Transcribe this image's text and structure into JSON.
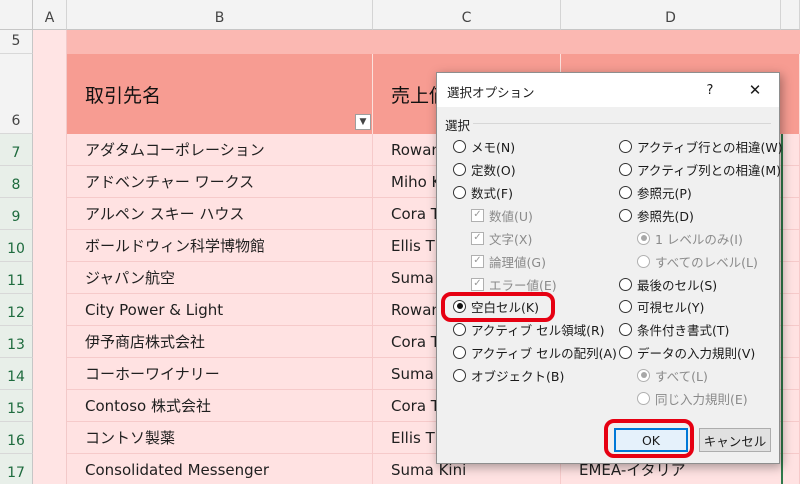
{
  "sheet": {
    "columns": [
      "A",
      "B",
      "C",
      "D"
    ],
    "rows": [
      "5",
      "6",
      "7",
      "8",
      "9",
      "10",
      "11",
      "12",
      "13",
      "14",
      "15",
      "16",
      "17"
    ],
    "header": {
      "b": "取引先名",
      "c": "売上価"
    },
    "data": [
      {
        "b": "アダタムコーポレーション",
        "c": "Rowan",
        "d": ""
      },
      {
        "b": "アドベンチャー ワークス",
        "c": "Miho K",
        "d": ""
      },
      {
        "b": "アルペン スキー ハウス",
        "c": "Cora T",
        "d": ""
      },
      {
        "b": "ボールドウィン科学博物館",
        "c": "Ellis T",
        "d": ""
      },
      {
        "b": "ジャパン航空",
        "c": "Suma",
        "d": ""
      },
      {
        "b": "City Power & Light",
        "c": "Rowan",
        "d": ""
      },
      {
        "b": "伊予商店株式会社",
        "c": "Cora T",
        "d": ""
      },
      {
        "b": "コーホーワイナリー",
        "c": "Suma",
        "d": ""
      },
      {
        "b": "Contoso 株式会社",
        "c": "Cora T",
        "d": ""
      },
      {
        "b": "コントソ製薬",
        "c": "Ellis T",
        "d": ""
      },
      {
        "b": "Consolidated Messenger",
        "c": "Suma Kini",
        "d": "EMEA-イタリア"
      }
    ],
    "filter_glyph": "▼",
    "colors": {
      "header_fill": "#f79c92",
      "row_fill": "#ffe2e2",
      "band_fill": "#fbb8b2"
    }
  },
  "dialog": {
    "title": "選択オプション",
    "help_label": "?",
    "close_label": "✕",
    "section_label": "選択",
    "left_options": [
      {
        "label": "メモ(N)",
        "state": "off"
      },
      {
        "label": "定数(O)",
        "state": "off"
      },
      {
        "label": "数式(F)",
        "state": "off"
      },
      {
        "label": "数値(U)",
        "state": "check-disabled"
      },
      {
        "label": "文字(X)",
        "state": "check-disabled"
      },
      {
        "label": "論理値(G)",
        "state": "check-disabled"
      },
      {
        "label": "エラー値(E)",
        "state": "check-disabled"
      },
      {
        "label": "空白セル(K)",
        "state": "on"
      },
      {
        "label": "アクティブ セル領域(R)",
        "state": "off"
      },
      {
        "label": "アクティブ セルの配列(A)",
        "state": "off"
      },
      {
        "label": "オブジェクト(B)",
        "state": "off"
      }
    ],
    "right_options": [
      {
        "label": "アクティブ行との相違(W)",
        "state": "off"
      },
      {
        "label": "アクティブ列との相違(M)",
        "state": "off"
      },
      {
        "label": "参照元(P)",
        "state": "off"
      },
      {
        "label": "参照先(D)",
        "state": "off"
      },
      {
        "label": "1 レベルのみ(I)",
        "state": "on-disabled"
      },
      {
        "label": "すべてのレベル(L)",
        "state": "off-disabled"
      },
      {
        "label": "最後のセル(S)",
        "state": "off"
      },
      {
        "label": "可視セル(Y)",
        "state": "off"
      },
      {
        "label": "条件付き書式(T)",
        "state": "off"
      },
      {
        "label": "データの入力規則(V)",
        "state": "off"
      },
      {
        "label": "すべて(L)",
        "state": "on-disabled"
      },
      {
        "label": "同じ入力規則(E)",
        "state": "off-disabled"
      }
    ],
    "ok_label": "OK",
    "cancel_label": "キャンセル",
    "highlight_color": "#e60012"
  }
}
